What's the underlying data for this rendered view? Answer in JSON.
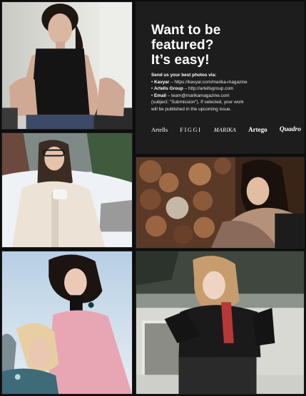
{
  "headline": {
    "line1": "Want to be",
    "line2": "featured?",
    "line3": "It’s easy!"
  },
  "instructions": {
    "lead": "Send us your best photos via:",
    "items": [
      {
        "name": "Kavyar",
        "detail": " – https://kavyar.com/marika-magazine"
      },
      {
        "name": "Artells Group",
        "detail": " – http://artellsgroup.com"
      },
      {
        "name": "Email",
        "detail": " – team@marikamagazine.com"
      }
    ],
    "note_line1": "(subject: \"Submission\"). If selected, your work",
    "note_line2": "will be published in the upcoming issue."
  },
  "logos": [
    "Artells",
    "FIGGI",
    "MARIKA",
    "Artego",
    "Quadro"
  ],
  "colors": {
    "page_background": "#0d0d0d",
    "panel_background": "#1d1d1d",
    "text": "#ffffff"
  },
  "photos": [
    {
      "id": "p1",
      "subject": "woman-black-tank-top"
    },
    {
      "id": "p2",
      "subject": "woman-headscarf-cream-coat-snow"
    },
    {
      "id": "p3",
      "subject": "woman-by-woodpile"
    },
    {
      "id": "p4",
      "subject": "two-women-embracing"
    },
    {
      "id": "p5",
      "subject": "woman-leaning-on-car"
    }
  ]
}
